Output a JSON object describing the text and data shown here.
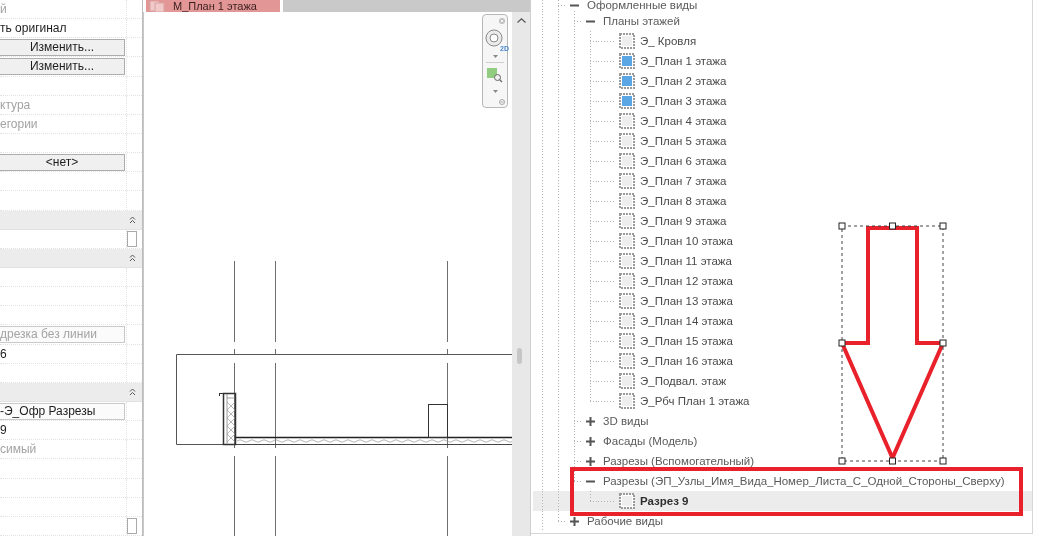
{
  "properties": {
    "rows": [
      {
        "kind": "text",
        "value": "й",
        "disabled": true
      },
      {
        "kind": "text",
        "value": "ть оригинал",
        "disabled": false
      },
      {
        "kind": "button",
        "label": "Изменить..."
      },
      {
        "kind": "button",
        "label": "Изменить..."
      },
      {
        "kind": "blank"
      },
      {
        "kind": "text",
        "value": "ктура",
        "disabled": true
      },
      {
        "kind": "text",
        "value": "егории",
        "disabled": true
      },
      {
        "kind": "blank"
      },
      {
        "kind": "button",
        "label": "<нет>"
      },
      {
        "kind": "blank"
      },
      {
        "kind": "blank"
      },
      {
        "kind": "header",
        "expanded": true
      },
      {
        "kind": "box"
      },
      {
        "kind": "header",
        "expanded": true
      },
      {
        "kind": "blank"
      },
      {
        "kind": "blank"
      },
      {
        "kind": "blank"
      },
      {
        "kind": "field",
        "value": "дрезка без линии",
        "disabled": true
      },
      {
        "kind": "text",
        "value": "6",
        "disabled": false
      },
      {
        "kind": "blank"
      },
      {
        "kind": "header",
        "expanded": true
      },
      {
        "kind": "field",
        "value": "-Э_Офр Разрезы",
        "disabled": false
      },
      {
        "kind": "text",
        "value": "9",
        "disabled": false
      },
      {
        "kind": "text",
        "value": "симый",
        "disabled": true
      },
      {
        "kind": "blank"
      },
      {
        "kind": "blank"
      },
      {
        "kind": "blank"
      },
      {
        "kind": "box"
      }
    ]
  },
  "view": {
    "tab": {
      "title": "М_План 1 этажа"
    },
    "navigation_bar": {
      "wheel_label": "2D"
    }
  },
  "project_browser": {
    "tree": [
      {
        "kind": "group",
        "label": "Оформленные виды",
        "expanded": true,
        "selected": false,
        "children": [
          {
            "kind": "group",
            "label": "Планы этажей",
            "expanded": true,
            "selected": false,
            "children": [
              {
                "kind": "view",
                "label": "Э_ Кровля",
                "selected": false,
                "active": false,
                "icon_filled": false
              },
              {
                "kind": "view",
                "label": "Э_План 1 этажа",
                "selected": false,
                "active": false,
                "icon_filled": true
              },
              {
                "kind": "view",
                "label": "Э_План 2 этажа",
                "selected": false,
                "active": false,
                "icon_filled": true
              },
              {
                "kind": "view",
                "label": "Э_План 3 этажа",
                "selected": false,
                "active": false,
                "icon_filled": true
              },
              {
                "kind": "view",
                "label": "Э_План 4 этажа",
                "selected": false,
                "active": false,
                "icon_filled": false
              },
              {
                "kind": "view",
                "label": "Э_План 5 этажа",
                "selected": false,
                "active": false,
                "icon_filled": false
              },
              {
                "kind": "view",
                "label": "Э_План 6 этажа",
                "selected": false,
                "active": false,
                "icon_filled": false
              },
              {
                "kind": "view",
                "label": "Э_План 7 этажа",
                "selected": false,
                "active": false,
                "icon_filled": false
              },
              {
                "kind": "view",
                "label": "Э_План 8 этажа",
                "selected": false,
                "active": false,
                "icon_filled": false
              },
              {
                "kind": "view",
                "label": "Э_План 9 этажа",
                "selected": false,
                "active": false,
                "icon_filled": false
              },
              {
                "kind": "view",
                "label": "Э_План 10 этажа",
                "selected": false,
                "active": false,
                "icon_filled": false
              },
              {
                "kind": "view",
                "label": "Э_План 11 этажа",
                "selected": false,
                "active": false,
                "icon_filled": false
              },
              {
                "kind": "view",
                "label": "Э_План 12 этажа",
                "selected": false,
                "active": false,
                "icon_filled": false
              },
              {
                "kind": "view",
                "label": "Э_План 13 этажа",
                "selected": false,
                "active": false,
                "icon_filled": false
              },
              {
                "kind": "view",
                "label": "Э_План 14 этажа",
                "selected": false,
                "active": false,
                "icon_filled": false
              },
              {
                "kind": "view",
                "label": "Э_План 15 этажа",
                "selected": false,
                "active": false,
                "icon_filled": false
              },
              {
                "kind": "view",
                "label": "Э_План 16 этажа",
                "selected": false,
                "active": false,
                "icon_filled": false
              },
              {
                "kind": "view",
                "label": "Э_Подвал. этаж",
                "selected": false,
                "active": false,
                "icon_filled": false
              },
              {
                "kind": "view",
                "label": "Э_Рбч План 1 этажа",
                "selected": false,
                "active": false,
                "icon_filled": false
              }
            ]
          },
          {
            "kind": "group",
            "label": "3D виды",
            "expanded": false,
            "selected": false
          },
          {
            "kind": "group",
            "label": "Фасады (Модель)",
            "expanded": false,
            "selected": false
          },
          {
            "kind": "group",
            "label": "Разрезы (Вспомогательный)",
            "expanded": false,
            "selected": false
          },
          {
            "kind": "group",
            "label": "Разрезы (ЭП_Узлы_Имя_Вида_Номер_Листа_С_Одной_Стороны_Сверху)",
            "expanded": true,
            "selected": false,
            "children": [
              {
                "kind": "view",
                "label": "Разрез 9",
                "selected": true,
                "active": true,
                "icon_filled": false
              }
            ]
          }
        ]
      },
      {
        "kind": "group",
        "label": "Рабочие виды",
        "expanded": false,
        "selected": false
      }
    ]
  },
  "annotations": {
    "arrow": true,
    "highlight_frame": true
  }
}
